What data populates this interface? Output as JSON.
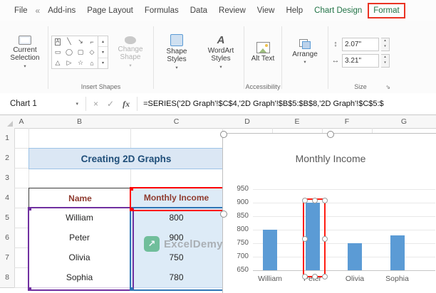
{
  "colors": {
    "contextual_tab_green": "#217346",
    "annotation_red": "#ea3323",
    "bar_fill": "#5b9bd5",
    "selection_red": "#ff1d12",
    "title_cell_bg": "#dbe7f4",
    "title_cell_text": "#1f4e79",
    "table_header_text": "#8e3a2e",
    "income_cell_bg": "#ddebf7",
    "name_range_border": "#7030a0",
    "income_range_border": "#2e75b6",
    "series_name_border": "#ff0000",
    "watermark_green": "#2fa463"
  },
  "icons": {
    "chevron": "▾",
    "overflow": "«",
    "cancel": "×",
    "enter": "✓",
    "fx": "fx",
    "height": "↕",
    "width": "↔",
    "launcher": "⇘",
    "wordart": "A",
    "scroll": [
      "▴",
      "▾",
      "▾"
    ],
    "watermark_arrow": "↗"
  },
  "ribbon": {
    "tabs": [
      {
        "label": "File",
        "style": "normal"
      },
      {
        "label": "«",
        "style": "icon",
        "name": "ribbon-overflow-icon"
      },
      {
        "label": "Add-ins",
        "style": "normal"
      },
      {
        "label": "Page Layout",
        "style": "normal"
      },
      {
        "label": "Formulas",
        "style": "normal"
      },
      {
        "label": "Data",
        "style": "normal"
      },
      {
        "label": "Review",
        "style": "normal"
      },
      {
        "label": "View",
        "style": "normal"
      },
      {
        "label": "Help",
        "style": "normal"
      },
      {
        "label": "Chart Design",
        "style": "contextual"
      },
      {
        "label": "Format",
        "style": "contextual-boxed"
      }
    ],
    "current_selection": {
      "label": "Current Selection"
    },
    "insert_shapes": {
      "label": "Insert Shapes",
      "gallery": [
        [
          "A",
          "╲",
          "↘",
          "⌐"
        ],
        [
          "▭",
          "◯",
          "▢",
          "◇"
        ],
        [
          "△",
          "▷",
          "☆",
          "⌂"
        ]
      ],
      "change_shape": "Change Shape"
    },
    "shape_styles": "Shape Styles",
    "wordart_styles": "WordArt Styles",
    "alt_text": "Alt Text",
    "accessibility_label": "Accessibility",
    "arrange": "Arrange",
    "size": {
      "label": "Size",
      "height_value": "2.07\"",
      "width_value": "3.21\""
    }
  },
  "formula_bar": {
    "name_box": "Chart 1",
    "formula": "=SERIES('2D Graph'!$C$4,'2D Graph'!$B$5:$B$8,'2D Graph'!$C$5:$"
  },
  "sheet": {
    "columns": [
      "A",
      "B",
      "C",
      "D",
      "E",
      "F",
      "G"
    ],
    "rows": [
      "1",
      "2",
      "3",
      "4",
      "5",
      "6",
      "7",
      "8"
    ],
    "title": "Creating 2D Graphs",
    "table": {
      "name_header": "Name",
      "income_header": "Monthly Income",
      "rows": [
        {
          "name": "William",
          "income": "800"
        },
        {
          "name": "Peter",
          "income": "900"
        },
        {
          "name": "Olivia",
          "income": "750"
        },
        {
          "name": "Sophia",
          "income": "780"
        }
      ]
    }
  },
  "watermark": {
    "text": "ExcelDemy"
  },
  "chart_data": {
    "type": "bar",
    "title": "Monthly Income",
    "categories": [
      "William",
      "Peter",
      "Olivia",
      "Sophia"
    ],
    "values": [
      800,
      900,
      750,
      780
    ],
    "xlabel": "",
    "ylabel": "",
    "ylim": [
      650,
      950
    ],
    "ytick_step": 50,
    "grid": true,
    "legend": "none",
    "bar_color": "#5b9bd5",
    "selected_category": "Peter"
  }
}
